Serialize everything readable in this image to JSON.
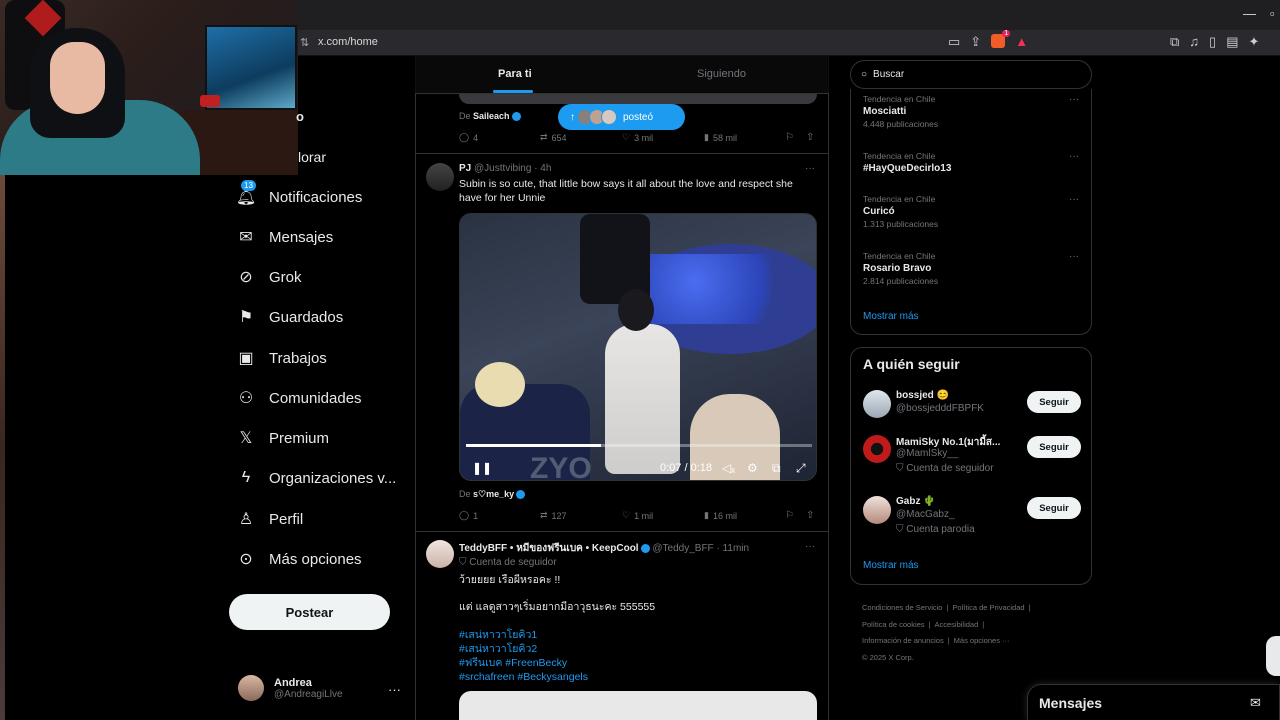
{
  "browser": {
    "url": "x.com/home",
    "brave_badge": "1"
  },
  "nav": {
    "partial_top_1": "o",
    "partial_top_2": "lorar",
    "notif_count": "13",
    "items": [
      {
        "label": "Notificaciones",
        "icon": "bell-icon"
      },
      {
        "label": "Mensajes",
        "icon": "mail-icon"
      },
      {
        "label": "Grok",
        "icon": "grok-icon"
      },
      {
        "label": "Guardados",
        "icon": "bookmark-icon"
      },
      {
        "label": "Trabajos",
        "icon": "briefcase-icon"
      },
      {
        "label": "Comunidades",
        "icon": "communities-icon"
      },
      {
        "label": "Premium",
        "icon": "x-logo-icon"
      },
      {
        "label": "Organizaciones v...",
        "icon": "lightning-icon"
      },
      {
        "label": "Perfil",
        "icon": "person-icon"
      },
      {
        "label": "Más opciones",
        "icon": "more-circle-icon"
      }
    ],
    "post_button": "Postear",
    "account": {
      "name": "Andrea",
      "handle": "@AndreagiLlve"
    }
  },
  "timeline": {
    "tabs": [
      "Para ti",
      "Siguiendo"
    ],
    "new_posts_pill": "posteó",
    "prev_tweet": {
      "from_prefix": "De",
      "from_name": "Saileach",
      "replies": "4",
      "reposts": "654",
      "likes": "3 mil",
      "views": "58 mil"
    },
    "tweet1": {
      "name": "PJ",
      "handle": "@Justtvibing",
      "time": "· 4h",
      "text": "Subin is so cute, that little bow says it all about the love and respect she have for her Unnie",
      "video_time": "0:07 / 0:18",
      "video_progress": 0.39,
      "watermark": "ZYO",
      "from_prefix": "De",
      "from_name": "s♡me_ky",
      "replies": "1",
      "reposts": "127",
      "likes": "1 mil",
      "views": "16 mil"
    },
    "tweet2": {
      "name": "TeddyBFF • หมีของฟรีนเบค • KeepCool",
      "handle": "@Teddy_BFF",
      "time": "· 11min",
      "badge": "Cuenta de seguidor",
      "line1": "ว้ายยยย เรือผีหรอคะ !!",
      "line2": "แต่ แลดูสาวๆเริ่มอยากมีอาวุธนะคะ 555555",
      "tags": [
        "#เสน่หาวาโยคิว1",
        "#เสน่หาวาโยคิว2",
        "#ฟรีนเบค #FreenBecky",
        "#srchafreen #Beckysangels"
      ]
    }
  },
  "right": {
    "search_placeholder": "Buscar",
    "trends": [
      {
        "context": "Tendencia en Chile",
        "name": "Mosciatti",
        "count": "4.448 publicaciones"
      },
      {
        "context": "Tendencia en Chile",
        "name": "#HayQueDecirlo13",
        "count": ""
      },
      {
        "context": "Tendencia en Chile",
        "name": "Curicó",
        "count": "1.313 publicaciones"
      },
      {
        "context": "Tendencia en Chile",
        "name": "Rosario Bravo",
        "count": "2.814 publicaciones"
      }
    ],
    "trends_more": "Mostrar más",
    "who_to_follow_title": "A quién seguir",
    "follow": [
      {
        "name": "bossjed 😊",
        "handle": "@bossjedddFBPFK",
        "sub": "",
        "button": "Seguir"
      },
      {
        "name": "MamiSky No.1(มามี้ส...",
        "handle": "@MamlSky__",
        "sub": "Cuenta de seguidor",
        "button": "Seguir"
      },
      {
        "name": "Gabz 🌵",
        "handle": "@MacGabz_",
        "sub": "Cuenta parodia",
        "button": "Seguir"
      }
    ],
    "follow_more": "Mostrar más",
    "footer": [
      "Condiciones de Servicio",
      "|",
      "Política de Privacidad",
      "|",
      "Política de cookies",
      "|",
      "Accesibilidad",
      "|",
      "Información de anuncios",
      "|",
      "Más opciones ···",
      "© 2025 X Corp."
    ],
    "messages_dock": "Mensajes"
  }
}
